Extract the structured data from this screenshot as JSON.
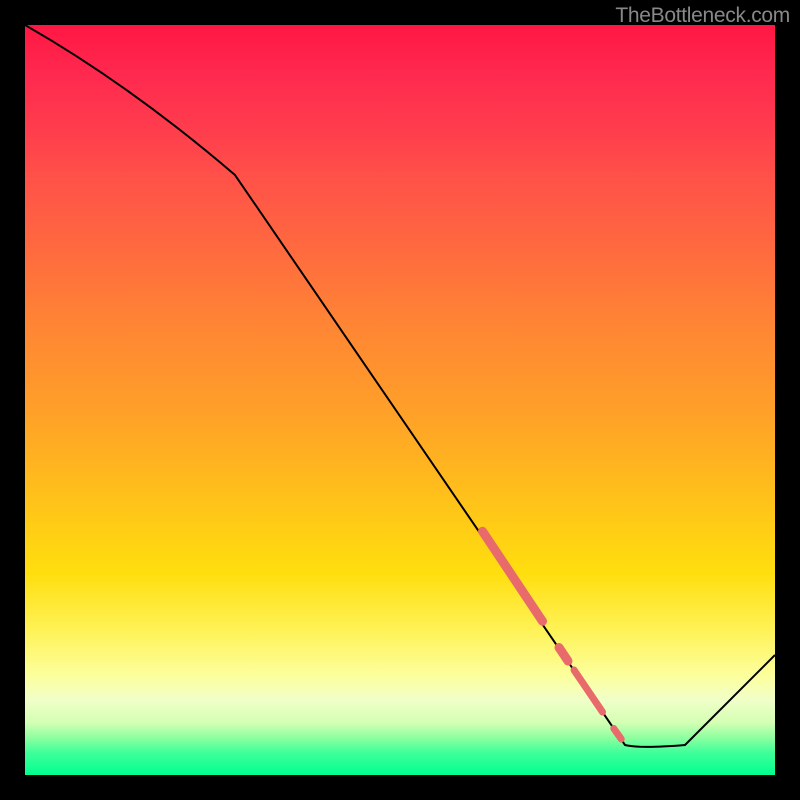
{
  "watermark": "TheBottleneck.com",
  "chart_data": {
    "type": "line",
    "title": "",
    "xlabel": "",
    "ylabel": "",
    "xlim": [
      0,
      100
    ],
    "ylim": [
      0,
      100
    ],
    "gradient_colors": {
      "top": "#ff1744",
      "upper_mid": "#ff8534",
      "mid": "#ffde0e",
      "lower_mid": "#fcffa0",
      "bottom": "#00ff90"
    },
    "curve": {
      "color": "#000000",
      "width": 2,
      "points": [
        {
          "x": 0,
          "y": 100
        },
        {
          "x": 28,
          "y": 80
        },
        {
          "x": 80,
          "y": 4
        },
        {
          "x": 88,
          "y": 4
        },
        {
          "x": 100,
          "y": 16
        }
      ]
    },
    "highlight_segments": {
      "color": "#e86a6a",
      "segments": [
        {
          "x1": 61,
          "y1": 32.5,
          "x2": 69,
          "y2": 20.5,
          "width": 9
        },
        {
          "x1": 71.2,
          "y1": 17,
          "x2": 72.4,
          "y2": 15.2,
          "width": 9
        },
        {
          "x1": 73.2,
          "y1": 14,
          "x2": 77,
          "y2": 8.4,
          "width": 7
        },
        {
          "x1": 78.5,
          "y1": 6.2,
          "x2": 79.5,
          "y2": 4.8,
          "width": 7
        }
      ]
    }
  }
}
